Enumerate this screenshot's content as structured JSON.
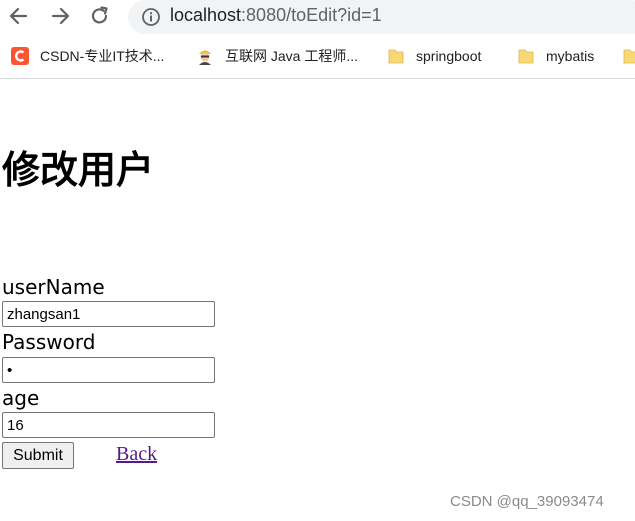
{
  "browser": {
    "url_host": "localhost",
    "url_rest": ":8080/toEdit?id=1",
    "bookmarks": [
      {
        "label": "CSDN-专业IT技术...",
        "icon": "csdn-logo-icon"
      },
      {
        "label": "互联网 Java 工程师...",
        "icon": "avatar-icon"
      },
      {
        "label": "springboot",
        "icon": "folder-icon"
      },
      {
        "label": "mybatis",
        "icon": "folder-icon"
      }
    ]
  },
  "page": {
    "title": "修改用户",
    "form": {
      "username_label": "userName",
      "username_value": "zhangsan1",
      "password_label": "Password",
      "password_value": "•",
      "age_label": "age",
      "age_value": "16",
      "submit_label": "Submit",
      "back_label": "Back"
    }
  },
  "watermark": "CSDN @qq_39093474",
  "colors": {
    "link_visited": "#551a8b",
    "omnibox_bg": "#f1f3f4",
    "csdn_brand": "#fc5531",
    "folder": "#f8d775"
  }
}
